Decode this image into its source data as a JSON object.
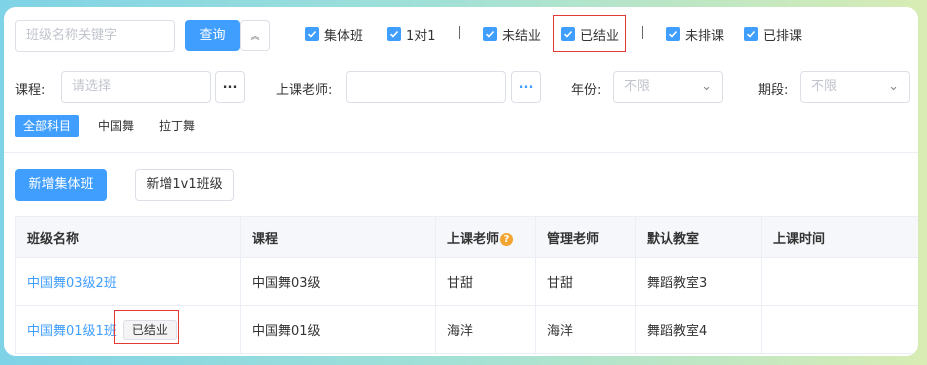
{
  "search": {
    "placeholder": "班级名称关键字",
    "query_label": "查询",
    "collapse_icon": "double-chevron-up-icon"
  },
  "filters": {
    "checkboxes": [
      {
        "label": "集体班",
        "checked": true
      },
      {
        "label": "1对1",
        "checked": true
      },
      {
        "label": "未结业",
        "checked": true
      },
      {
        "label": "已结业",
        "checked": true
      },
      {
        "label": "未排课",
        "checked": true
      },
      {
        "label": "已排课",
        "checked": true
      }
    ],
    "separator": "|"
  },
  "form": {
    "course_label": "课程:",
    "course_placeholder": "请选择",
    "teacher_label": "上课老师:",
    "teacher_value": "",
    "picker_button": "...",
    "year_label": "年份:",
    "year_value": "不限",
    "period_label": "期段:",
    "period_value": "不限"
  },
  "subjects": [
    "全部科目",
    "中国舞",
    "拉丁舞"
  ],
  "actions": {
    "add_group": "新增集体班",
    "add_1v1": "新增1v1班级"
  },
  "table": {
    "headers": [
      "班级名称",
      "课程",
      "上课老师",
      "管理老师",
      "默认教室",
      "上课时间"
    ],
    "help_icon": "?",
    "rows": [
      {
        "name": "中国舞03级2班",
        "status": "",
        "course": "中国舞03级",
        "teacher": "甘甜",
        "manager": "甘甜",
        "room": "舞蹈教室3",
        "time": ""
      },
      {
        "name": "中国舞01级1班",
        "status": "已结业",
        "course": "中国舞01级",
        "teacher": "海洋",
        "manager": "海洋",
        "room": "舞蹈教室4",
        "time": ""
      }
    ]
  },
  "colors": {
    "primary": "#409eff",
    "highlight": "#e53935",
    "help": "#f2a530"
  }
}
